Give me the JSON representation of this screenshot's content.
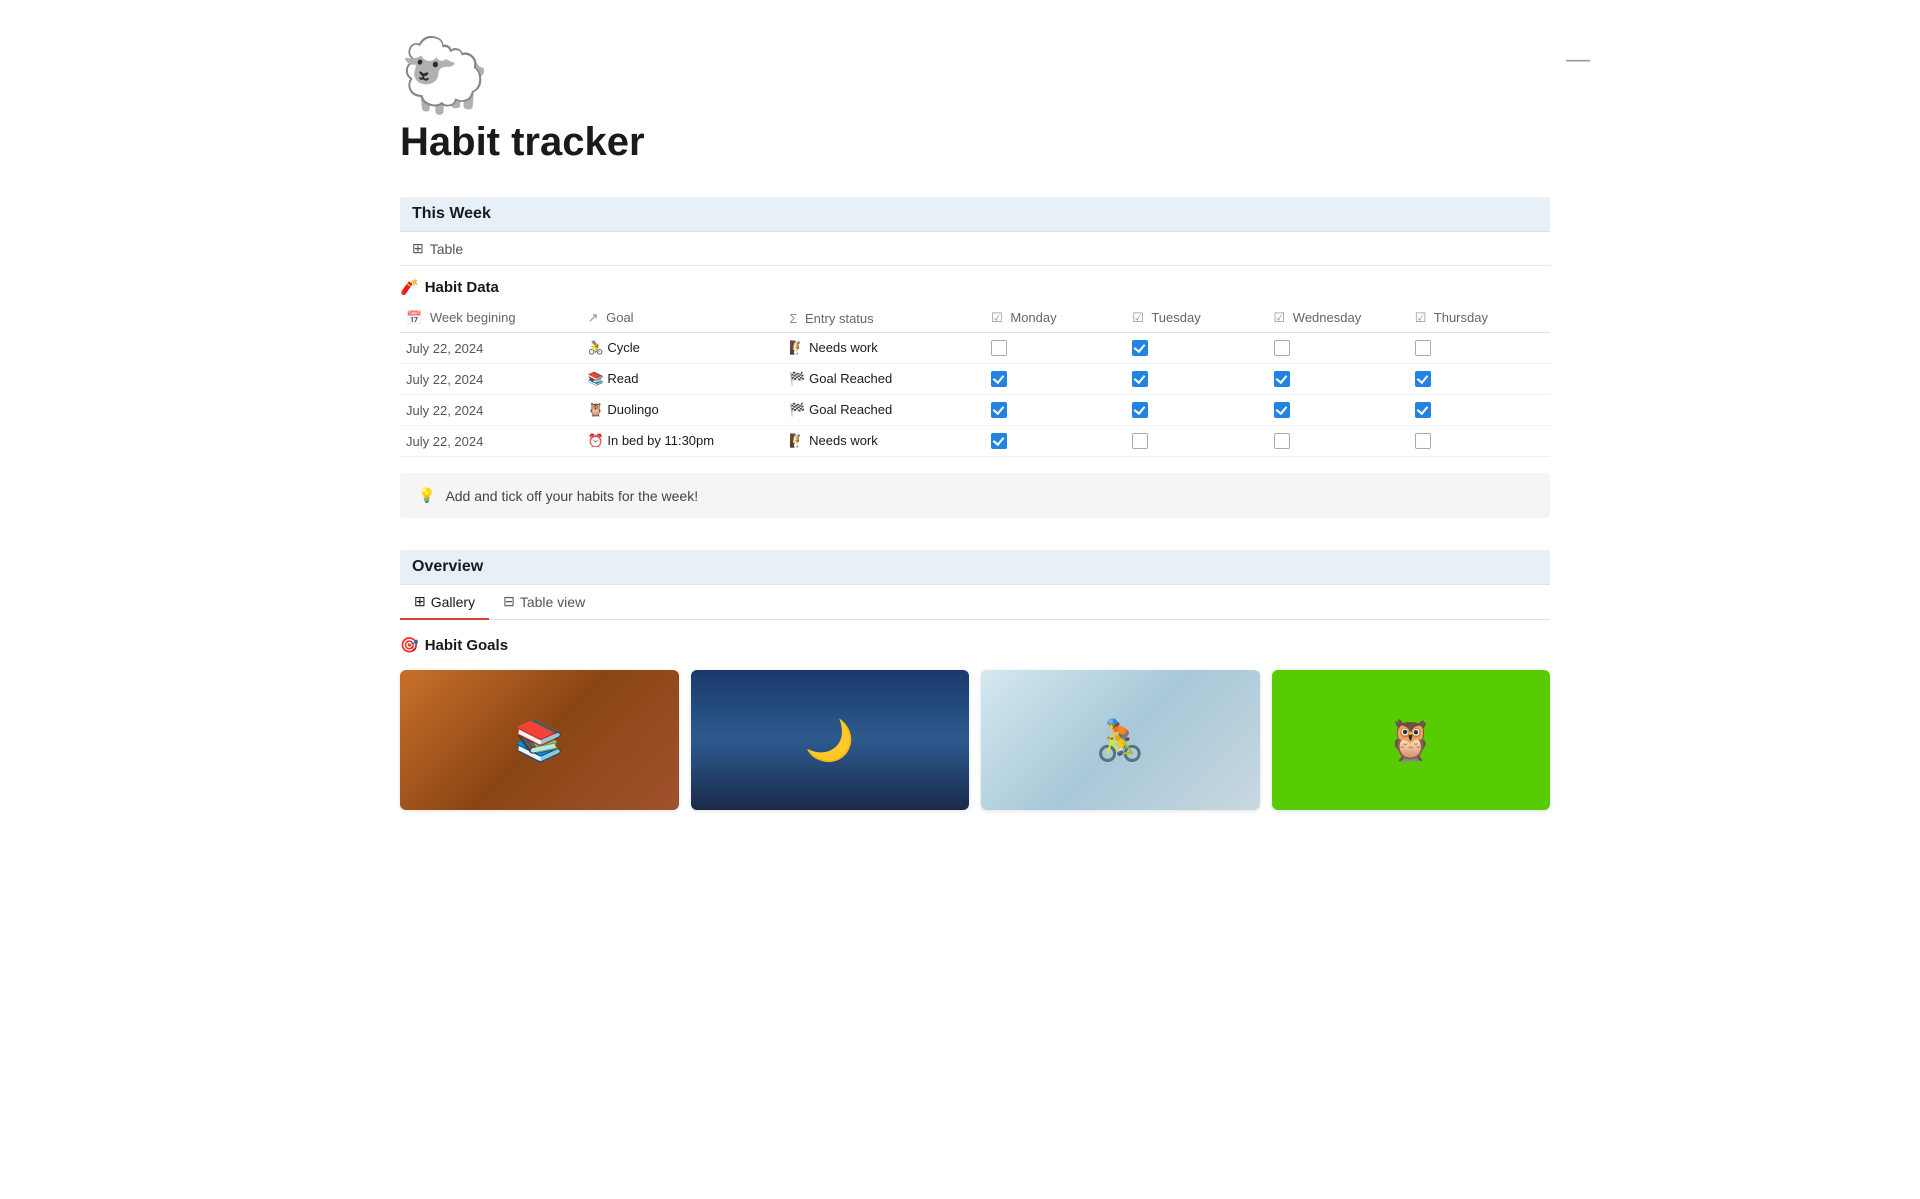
{
  "page": {
    "icon": "🐑",
    "title": "Habit tracker",
    "minimize_label": "—"
  },
  "this_week": {
    "section_title": "This Week",
    "view_icon": "⊞",
    "view_label": "Table"
  },
  "habit_data": {
    "header_icon": "🧨",
    "header_label": "Habit Data",
    "columns": {
      "week_beginning": "Week begining",
      "goal": "Goal",
      "entry_status": "Entry status",
      "monday": "Monday",
      "tuesday": "Tuesday",
      "wednesday": "Wednesday",
      "thursday": "Thursday"
    },
    "rows": [
      {
        "date": "July 22, 2024",
        "goal_icon": "🚴",
        "goal": "Cycle",
        "status_icon": "🧗",
        "status": "Needs work",
        "monday": false,
        "tuesday": true,
        "wednesday": false,
        "thursday": false
      },
      {
        "date": "July 22, 2024",
        "goal_icon": "📚",
        "goal": "Read",
        "status_icon": "🏁",
        "status": "Goal Reached",
        "monday": true,
        "tuesday": true,
        "wednesday": true,
        "thursday": true
      },
      {
        "date": "July 22, 2024",
        "goal_icon": "🦉",
        "goal": "Duolingo",
        "status_icon": "🏁",
        "status": "Goal Reached",
        "monday": true,
        "tuesday": true,
        "wednesday": true,
        "thursday": true
      },
      {
        "date": "July 22, 2024",
        "goal_icon": "⏰",
        "goal": "In bed by 11:30pm",
        "status_icon": "🧗",
        "status": "Needs work",
        "monday": true,
        "tuesday": false,
        "wednesday": false,
        "thursday": false
      }
    ]
  },
  "tip": {
    "icon": "💡",
    "text": "Add and tick off your habits for the week!"
  },
  "overview": {
    "section_title": "Overview",
    "tabs": [
      {
        "id": "gallery",
        "icon": "⊞",
        "label": "Gallery",
        "active": true
      },
      {
        "id": "table",
        "icon": "⊟",
        "label": "Table view",
        "active": false
      }
    ]
  },
  "habit_goals": {
    "header_icon": "🎯",
    "header_label": "Habit Goals",
    "cards": [
      {
        "id": "read",
        "emoji": "📚",
        "bg_class": "img-books"
      },
      {
        "id": "lamp",
        "emoji": "🌙",
        "bg_class": "img-lamp"
      },
      {
        "id": "cycle",
        "emoji": "🚴",
        "bg_class": "img-bike"
      },
      {
        "id": "duolingo",
        "emoji": "🦉",
        "bg_class": "img-duolingo"
      }
    ]
  }
}
